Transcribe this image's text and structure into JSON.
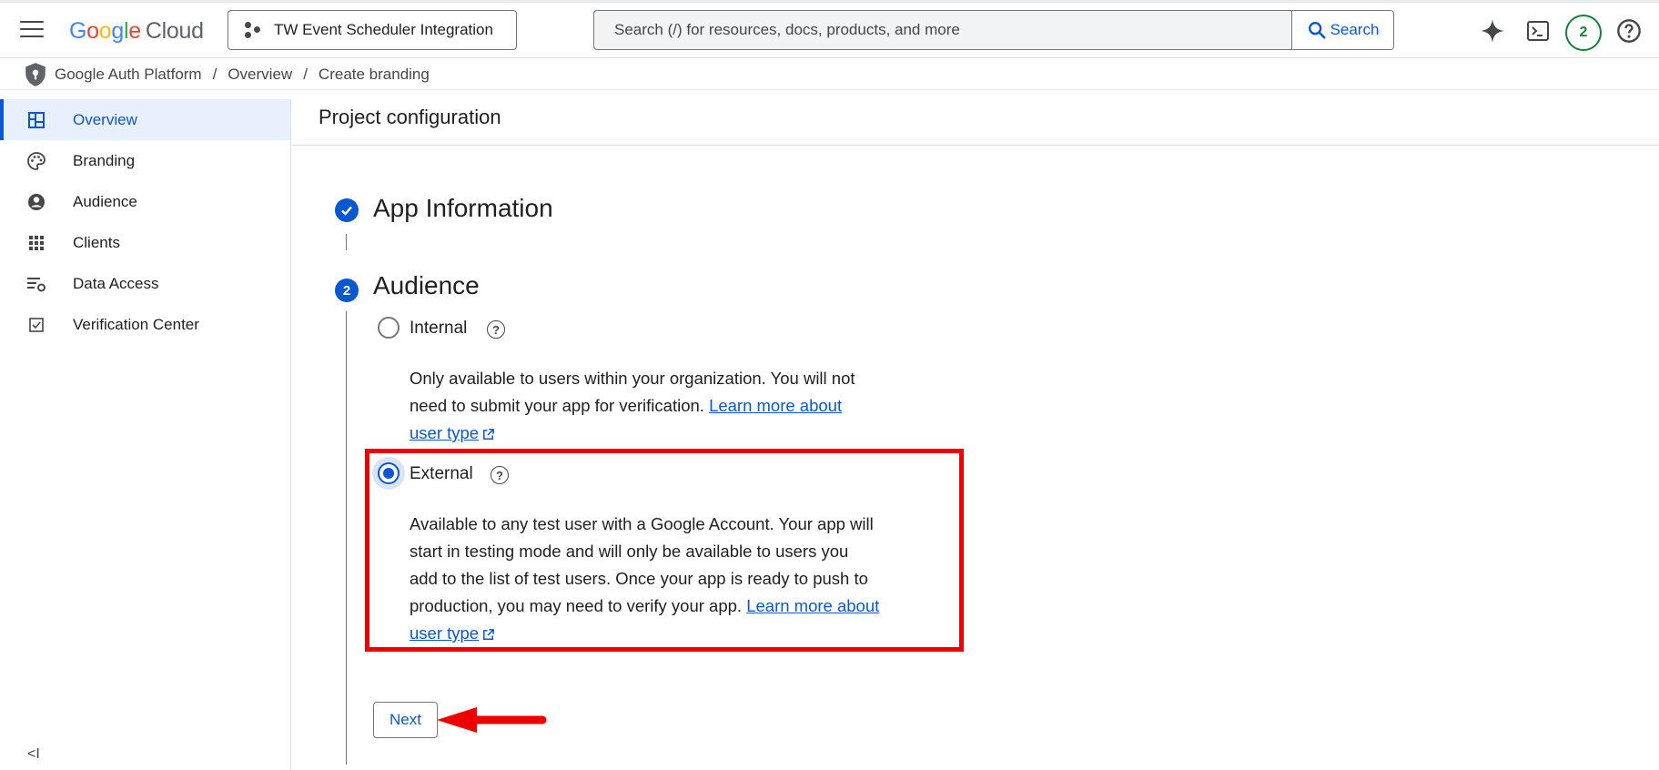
{
  "header": {
    "logo_google": [
      "G",
      "o",
      "o",
      "g",
      "l",
      "e"
    ],
    "logo_cloud": "Cloud",
    "project_name": "TW Event Scheduler Integration",
    "search_placeholder": "Search (/) for resources, docs, products, and more",
    "search_button": "Search",
    "notification_count": "2"
  },
  "breadcrumb": {
    "items": [
      "Google Auth Platform",
      "Overview",
      "Create branding"
    ],
    "separator": "/"
  },
  "sidebar": {
    "items": [
      {
        "label": "Overview",
        "icon": "dashboard-icon",
        "active": true
      },
      {
        "label": "Branding",
        "icon": "palette-icon"
      },
      {
        "label": "Audience",
        "icon": "account-circle-icon"
      },
      {
        "label": "Clients",
        "icon": "grid-apps-icon"
      },
      {
        "label": "Data Access",
        "icon": "list-settings-icon"
      },
      {
        "label": "Verification Center",
        "icon": "checkbox-icon"
      }
    ],
    "collapse_label": "<I"
  },
  "main": {
    "title": "Project configuration",
    "step1": {
      "title": "App Information",
      "status": "complete"
    },
    "step2": {
      "number": "2",
      "title": "Audience",
      "internal": {
        "label": "Internal",
        "desc_line1": "Only available to users within your organization. You will not",
        "desc_line2": "need to submit your app for verification.",
        "link_part1": "Learn more about",
        "link_part2": "user type"
      },
      "external": {
        "label": "External",
        "selected": true,
        "desc_line1": "Available to any test user with a Google Account. Your app will",
        "desc_line2": "start in testing mode and will only be available to users you",
        "desc_line3": "add to the list of test users. Once your app is ready to push to",
        "desc_line4": "production, you may need to verify your app.",
        "link_part1": "Learn more about",
        "link_part2": "user type"
      },
      "next_button": "Next"
    }
  },
  "colors": {
    "accent": "#0b57d0",
    "highlight": "#ee0000",
    "badge": "#188038"
  }
}
